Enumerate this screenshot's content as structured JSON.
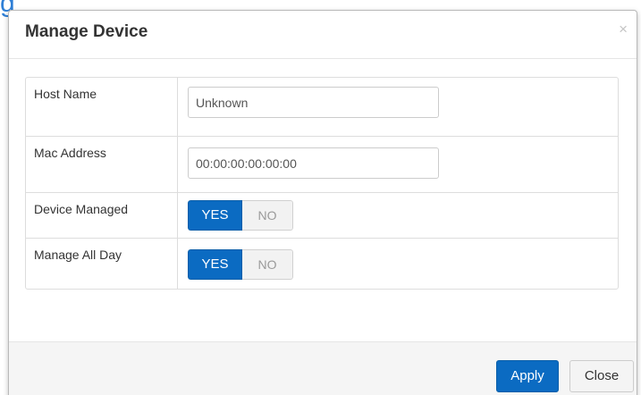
{
  "background": {
    "partial_text": "g"
  },
  "modal": {
    "title": "Manage Device",
    "close_glyph": "×",
    "fields": {
      "host_name": {
        "label": "Host Name",
        "value": "Unknown"
      },
      "mac_address": {
        "label": "Mac Address",
        "value": "00:00:00:00:00:00"
      },
      "device_managed": {
        "label": "Device Managed",
        "yes_label": "YES",
        "no_label": "NO",
        "selected": "YES"
      },
      "manage_all_day": {
        "label": "Manage All Day",
        "yes_label": "YES",
        "no_label": "NO",
        "selected": "YES"
      }
    },
    "footer": {
      "apply_label": "Apply",
      "close_label": "Close"
    }
  },
  "colors": {
    "accent": "#0b6bc2",
    "background_text": "#2f7fd6",
    "toggle_off": "#f2f2f2",
    "footer_bg": "#f5f5f5"
  },
  "icons": {
    "close": "close-icon"
  }
}
